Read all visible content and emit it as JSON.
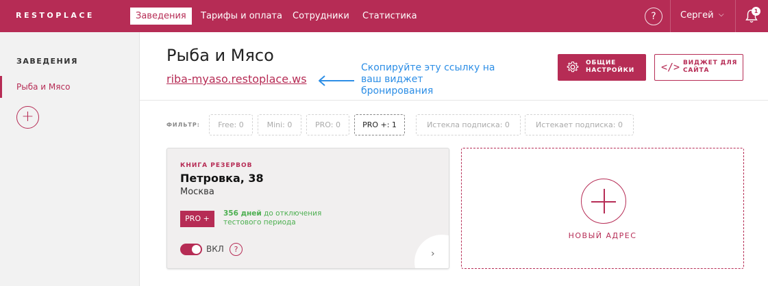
{
  "brand": {
    "logo": "RESTOPLACE",
    "accent": "#b62c55",
    "hint_color": "#2c8ee6",
    "success_color": "#4caf50"
  },
  "nav": {
    "items": [
      {
        "label": "Заведения",
        "active": true
      },
      {
        "label": "Тарифы и оплата",
        "active": false
      },
      {
        "label": "Сотрудники",
        "active": false
      },
      {
        "label": "Статистика",
        "active": false
      }
    ],
    "help": "?",
    "user": "Сергей",
    "notifications": "1"
  },
  "sidebar": {
    "title": "ЗАВЕДЕНИЯ",
    "items": [
      {
        "label": "Рыба и Мясо",
        "active": true
      }
    ],
    "add": "+"
  },
  "header": {
    "title": "Рыба и Мясо",
    "link": "riba-myaso.restoplace.ws",
    "hint": "Скопируйте эту ссылку на ваш виджет бронирования",
    "settings_button": "ОБЩИЕ НАСТРОЙКИ",
    "widget_button": "ВИДЖЕТ ДЛЯ САЙТА",
    "widget_icon": "</>"
  },
  "filters": {
    "label": "ФИЛЬТР:",
    "chips": [
      {
        "label": "Free: 0",
        "active": false
      },
      {
        "label": "Mini: 0",
        "active": false
      },
      {
        "label": "PRO: 0",
        "active": false
      },
      {
        "label": "PRO +: 1",
        "active": true
      },
      {
        "label": "Истекла подписка: 0",
        "active": false
      },
      {
        "label": "Истекает подписка: 0",
        "active": false
      }
    ]
  },
  "venue": {
    "category": "КНИГА РЕЗЕРВОВ",
    "address": "Петровка, 38",
    "city": "Москва",
    "plan": "PRO +",
    "trial_days": "356 дней",
    "trial_rest": "до отключения тестового периода",
    "toggle_label": "ВКЛ",
    "toggle_on": true,
    "help": "?",
    "next": "›"
  },
  "new_address": {
    "label": "НОВЫЙ АДРЕС"
  }
}
